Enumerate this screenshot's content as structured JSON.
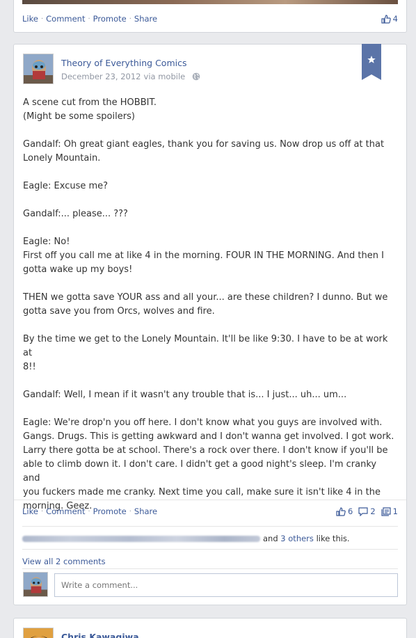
{
  "previous_post": {
    "actions": [
      "Like",
      "Comment",
      "Promote",
      "Share"
    ],
    "likes": "4"
  },
  "post": {
    "author": "Theory of Everything Comics",
    "date": "December 23, 2012",
    "via": "via mobile",
    "icons": {
      "audience": "globe-icon",
      "bookmark": "star-bookmark-icon"
    },
    "text": "A scene cut from the HOBBIT.\n(Might be some spoilers)\n\nGandalf: Oh great giant eagles, thank you for saving us. Now drop us off at that\nLonely Mountain.\n\nEagle: Excuse me?\n\nGandalf:... please... ???\n\nEagle: No!\nFirst off you call me at like 4 in the morning. FOUR IN THE MORNING. And then I\ngotta wake up my boys!\n\nTHEN we gotta save YOUR ass and all your... are these children? I dunno. But we\ngotta save you from Orcs, wolves and fire.\n\nBy the time we get to the Lonely Mountain. It'll be like 9:30. I have to be at work at\n8!!\n\nGandalf: Well, I mean if it wasn't any trouble that is... I just... uh... um...\n\nEagle: We're drop'n you off here. I don't know what you guys are involved with.\nGangs. Drugs. This is getting awkward and I don't wanna get involved. I got work.\nLarry there gotta be at school. There's a rock over there. I don't know if you'll be\nable to climb down it. I don't care. I didn't get a good night's sleep. I'm cranky and\nyou fuckers made me cranky. Next time you call, make sure it isn't like 4 in the\nmorning. Geez.",
    "actions": [
      "Like",
      "Comment",
      "Promote",
      "Share"
    ],
    "likes": "6",
    "comments": "2",
    "shares": "1",
    "likers_suffix_pre": "and",
    "likers_others": "3 others",
    "likers_suffix_post": "like this.",
    "view_comments": "View all 2 comments",
    "comment_placeholder": "Write a comment..."
  },
  "next_post": {
    "author": "Chris Kawagiwa"
  },
  "colors": {
    "link": "#3b5998",
    "background": "#e9eaed",
    "bookmark": "#5b74a8"
  }
}
